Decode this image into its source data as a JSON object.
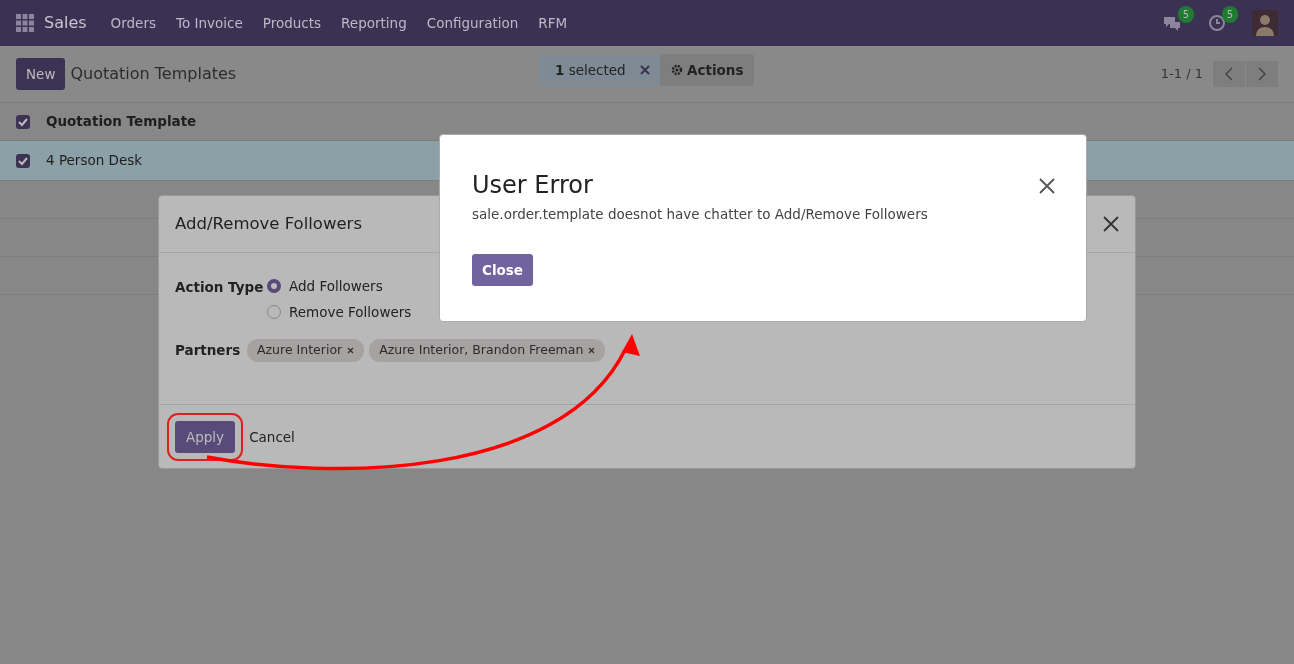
{
  "navbar": {
    "app": "Sales",
    "menu": [
      "Orders",
      "To Invoice",
      "Products",
      "Reporting",
      "Configuration",
      "RFM"
    ],
    "messages_badge": "5",
    "activities_badge": "5"
  },
  "control_panel": {
    "new_button": "New",
    "title": "Quotation Templates",
    "selection": "**1** selected",
    "actions_button": "Actions",
    "pager": "1-1 / 1"
  },
  "list": {
    "header": {
      "label": "Quotation Template",
      "checked": true
    },
    "rows": [
      {
        "label": "4 Person Desk",
        "checked": true,
        "selected": true
      }
    ]
  },
  "followers_dialog": {
    "title": "Add/Remove Followers",
    "action_type_label": "Action Type",
    "options": [
      {
        "label": "Add Followers",
        "selected": true
      },
      {
        "label": "Remove Followers",
        "selected": false
      }
    ],
    "partners_label": "Partners",
    "partners": [
      "Azure Interior",
      "Azure Interior, Brandon Freeman"
    ],
    "apply_button": "Apply",
    "cancel_button": "Cancel"
  },
  "error_dialog": {
    "title": "User Error",
    "message": "sale.order.template doesnot have chatter to Add/Remove Followers",
    "close_button": "Close"
  }
}
